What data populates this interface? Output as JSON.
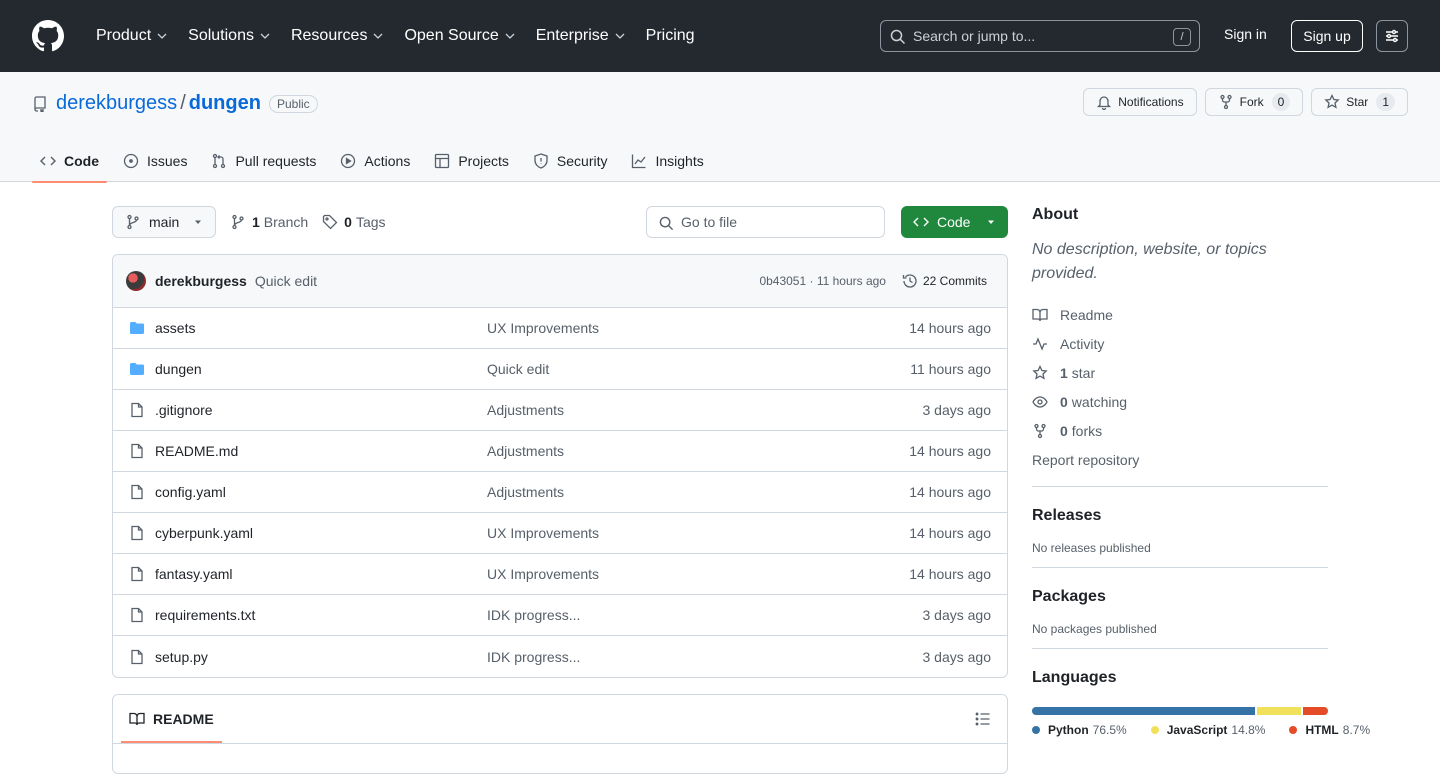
{
  "header": {
    "nav": [
      {
        "label": "Product",
        "dropdown": true
      },
      {
        "label": "Solutions",
        "dropdown": true
      },
      {
        "label": "Resources",
        "dropdown": true
      },
      {
        "label": "Open Source",
        "dropdown": true
      },
      {
        "label": "Enterprise",
        "dropdown": true
      },
      {
        "label": "Pricing",
        "dropdown": false
      }
    ],
    "search_placeholder": "Search or jump to...",
    "search_shortcut": "/",
    "sign_in": "Sign in",
    "sign_up": "Sign up"
  },
  "repo": {
    "owner": "derekburgess",
    "separator": "/",
    "name": "dungen",
    "visibility": "Public",
    "notifications_label": "Notifications",
    "fork_label": "Fork",
    "fork_count": "0",
    "star_label": "Star",
    "star_count": "1",
    "tabs": [
      {
        "label": "Code",
        "icon": "code-icon",
        "active": true
      },
      {
        "label": "Issues",
        "icon": "issue-icon",
        "active": false
      },
      {
        "label": "Pull requests",
        "icon": "pull-request-icon",
        "active": false
      },
      {
        "label": "Actions",
        "icon": "play-icon",
        "active": false
      },
      {
        "label": "Projects",
        "icon": "table-icon",
        "active": false
      },
      {
        "label": "Security",
        "icon": "shield-icon",
        "active": false
      },
      {
        "label": "Insights",
        "icon": "graph-icon",
        "active": false
      }
    ]
  },
  "toolbar": {
    "branch": "main",
    "branch_count": "1",
    "branch_label": "Branch",
    "tag_count": "0",
    "tag_label": "Tags",
    "goto_placeholder": "Go to file",
    "code_button": "Code"
  },
  "commit": {
    "author": "derekburgess",
    "message": "Quick edit",
    "hash_time": "0b43051 · 11 hours ago",
    "commits_label": "22 Commits"
  },
  "files": [
    {
      "name": "assets",
      "type": "folder",
      "message": "UX Improvements",
      "date": "14 hours ago"
    },
    {
      "name": "dungen",
      "type": "folder",
      "message": "Quick edit",
      "date": "11 hours ago"
    },
    {
      "name": ".gitignore",
      "type": "file",
      "message": "Adjustments",
      "date": "3 days ago"
    },
    {
      "name": "README.md",
      "type": "file",
      "message": "Adjustments",
      "date": "14 hours ago"
    },
    {
      "name": "config.yaml",
      "type": "file",
      "message": "Adjustments",
      "date": "14 hours ago"
    },
    {
      "name": "cyberpunk.yaml",
      "type": "file",
      "message": "UX Improvements",
      "date": "14 hours ago"
    },
    {
      "name": "fantasy.yaml",
      "type": "file",
      "message": "UX Improvements",
      "date": "14 hours ago"
    },
    {
      "name": "requirements.txt",
      "type": "file",
      "message": "IDK progress...",
      "date": "3 days ago"
    },
    {
      "name": "setup.py",
      "type": "file",
      "message": "IDK progress...",
      "date": "3 days ago"
    }
  ],
  "readme": {
    "tab_label": "README"
  },
  "about": {
    "title": "About",
    "description": "No description, website, or topics provided.",
    "items": [
      {
        "icon": "book-icon",
        "count": "",
        "label": "Readme"
      },
      {
        "icon": "pulse-icon",
        "count": "",
        "label": "Activity"
      },
      {
        "icon": "star-icon",
        "count": "1",
        "label": "star"
      },
      {
        "icon": "eye-icon",
        "count": "0",
        "label": "watching"
      },
      {
        "icon": "fork-icon",
        "count": "0",
        "label": "forks"
      }
    ],
    "report": "Report repository"
  },
  "releases": {
    "title": "Releases",
    "note": "No releases published"
  },
  "packages": {
    "title": "Packages",
    "note": "No packages published"
  },
  "languages": {
    "title": "Languages",
    "items": [
      {
        "name": "Python",
        "percent": "76.5%",
        "value": 76.5,
        "color": "#3572A5"
      },
      {
        "name": "JavaScript",
        "percent": "14.8%",
        "value": 14.8,
        "color": "#f1e05a"
      },
      {
        "name": "HTML",
        "percent": "8.7%",
        "value": 8.7,
        "color": "#e34c26"
      }
    ]
  },
  "colors": {
    "header_bg": "#24292f",
    "link": "#0969da",
    "primary_button": "#1f883d",
    "tab_underline": "#fd8c73",
    "folder": "#54aeff"
  }
}
